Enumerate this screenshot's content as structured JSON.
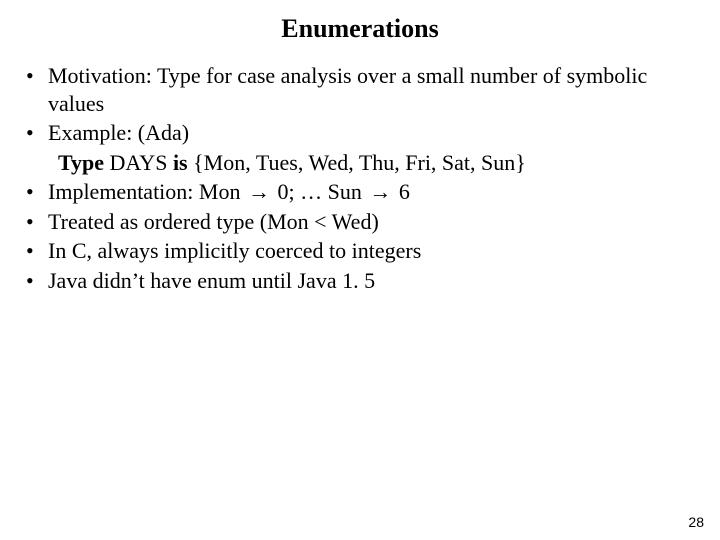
{
  "title": "Enumerations",
  "bullets": {
    "b0": "Motivation: Type for case analysis over a small number of symbolic values",
    "b1": "Example: (Ada)",
    "sub1_pre": "Type",
    "sub1_mid": " DAYS ",
    "sub1_is": "is",
    "sub1_rest": " {Mon, Tues, Wed, Thu, Fri, Sat, Sun}",
    "b2_pre": "Implementation: Mon ",
    "b2_arrow1": "→",
    "b2_mid": " 0; … Sun ",
    "b2_arrow2": "→",
    "b2_post": " 6",
    "b3": "Treated as ordered type (Mon < Wed)",
    "b4": "In C, always implicitly coerced to integers",
    "b5": "Java didn’t have enum until Java 1. 5"
  },
  "page_number": "28"
}
